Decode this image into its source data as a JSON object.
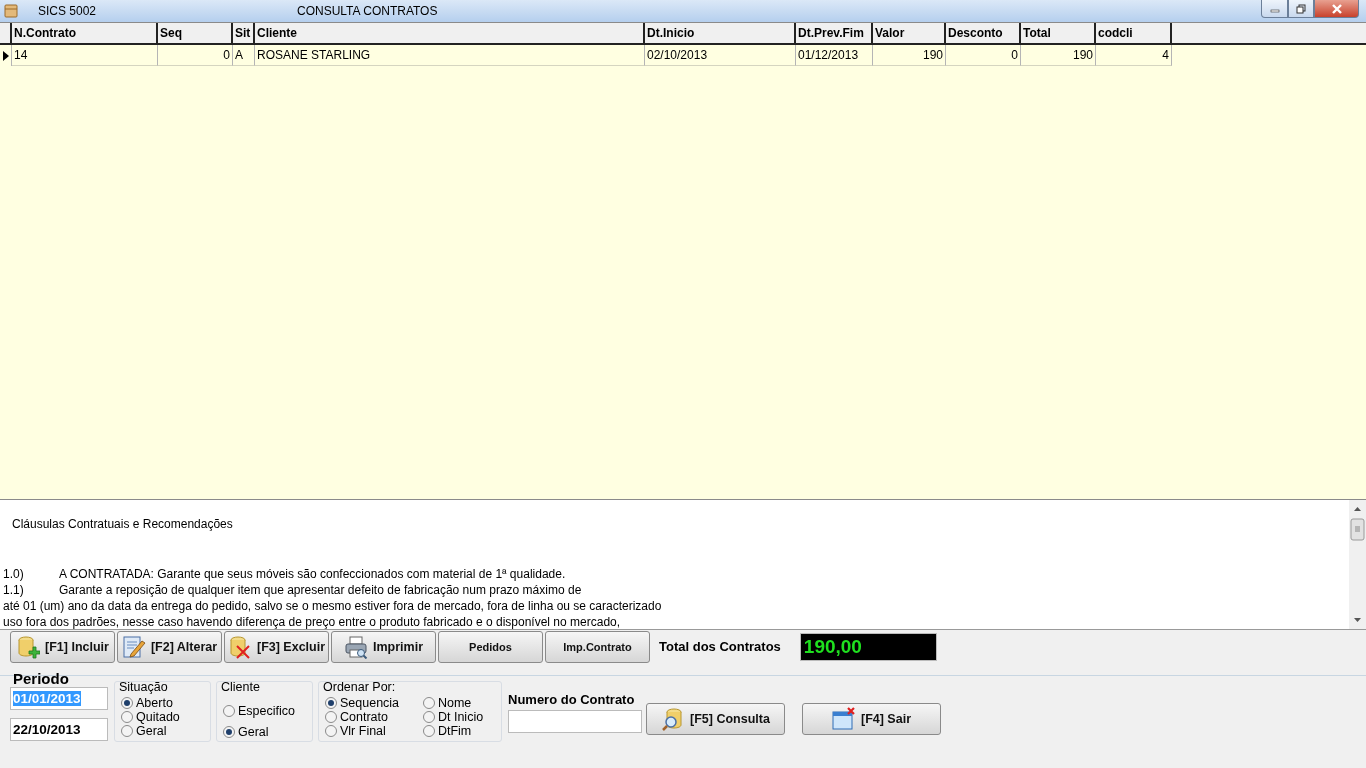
{
  "window": {
    "app_name": "SICS 5002",
    "title": "CONSULTA CONTRATOS"
  },
  "table": {
    "columns": [
      {
        "label": "N.Contrato",
        "kind": "text"
      },
      {
        "label": "Seq",
        "kind": "number"
      },
      {
        "label": "Sit",
        "kind": "text"
      },
      {
        "label": "Cliente",
        "kind": "text"
      },
      {
        "label": "Dt.Inicio",
        "kind": "text"
      },
      {
        "label": "Dt.Prev.Fim",
        "kind": "text"
      },
      {
        "label": "Valor",
        "kind": "number"
      },
      {
        "label": "Desconto",
        "kind": "number"
      },
      {
        "label": "Total",
        "kind": "number"
      },
      {
        "label": "codcli",
        "kind": "number"
      }
    ],
    "rows": [
      {
        "current": true,
        "cells": [
          "14",
          "0",
          "A",
          "ROSANE STARLING",
          "02/10/2013",
          "01/12/2013",
          "190",
          "0",
          "190",
          "4"
        ]
      }
    ]
  },
  "clauses": {
    "heading": "Cláusulas Contratuais e Recomendações",
    "lines": [
      {
        "number": "1.0)",
        "text": "A CONTRATADA: Garante que seus móveis são confeccionados com material de 1ª qualidade."
      },
      {
        "number": "1.1)",
        "text": "Garante a reposição de qualquer item que apresentar defeito de fabricação num prazo máximo de"
      },
      {
        "text": "até 01 (um) ano da data da entrega do pedido, salvo se o mesmo estiver fora de mercado, fora de linha ou se caracterizado"
      },
      {
        "text": "uso fora dos padrões, nesse caso havendo diferença de preço entre o produto fabricado e o disponível no mercado,"
      }
    ]
  },
  "toolbar": {
    "buttons": [
      {
        "label": "[F1] Incluir",
        "kind": "icon"
      },
      {
        "label": "[F2] Alterar",
        "kind": "icon"
      },
      {
        "label": "[F3] Excluir",
        "kind": "icon"
      },
      {
        "label": "Imprimir",
        "kind": "icon"
      },
      {
        "label": "Pedidos",
        "kind": "plain"
      },
      {
        "label": "Imp.Contrato",
        "kind": "plain"
      }
    ],
    "total_label": "Total dos Contratos",
    "total_value": "190,00"
  },
  "filters": {
    "period_label": "Periodo",
    "date_from": {
      "value": "01/01/2013",
      "text_selected": true
    },
    "date_to": {
      "value": "22/10/2013",
      "text_selected": false
    },
    "groups": [
      {
        "label": "Situação",
        "options": [
          {
            "label": "Aberto",
            "selected": true
          },
          {
            "label": "Quitado",
            "selected": false
          },
          {
            "label": "Geral",
            "selected": false
          }
        ]
      },
      {
        "label": "Cliente",
        "options": [
          {
            "label": "Especifico",
            "selected": false
          },
          {
            "label": "Geral",
            "selected": true
          }
        ]
      },
      {
        "label": "Ordenar Por:",
        "options": [
          {
            "label": "Sequencia",
            "selected": true
          },
          {
            "label": "Contrato",
            "selected": false
          },
          {
            "label": "Vlr Final",
            "selected": false
          },
          {
            "label": "Nome",
            "selected": false
          },
          {
            "label": "Dt Inicio",
            "selected": false
          },
          {
            "label": "DtFim",
            "selected": false
          }
        ]
      }
    ],
    "contract_number_label": "Numero do Contrato",
    "buttons": [
      {
        "label": "[F5] Consulta",
        "kind": "icon"
      },
      {
        "label": "[F4] Sair",
        "kind": "icon"
      }
    ]
  }
}
